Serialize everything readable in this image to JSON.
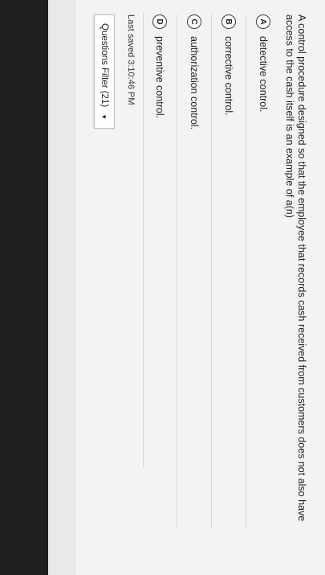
{
  "question": {
    "text": "A control procedure designed so that the employee that records cash received from customers does not also have access to the cash itself is an example of a(n)"
  },
  "options": [
    {
      "letter": "A",
      "text": "detective control."
    },
    {
      "letter": "B",
      "text": "corrective control."
    },
    {
      "letter": "C",
      "text": "authorization control."
    },
    {
      "letter": "D",
      "text": "preventive control."
    }
  ],
  "status": {
    "last_saved": "Last saved 3:10:46 PM"
  },
  "filter": {
    "label": "Questions Filter (21)",
    "caret_icon": "caret-down-icon"
  }
}
